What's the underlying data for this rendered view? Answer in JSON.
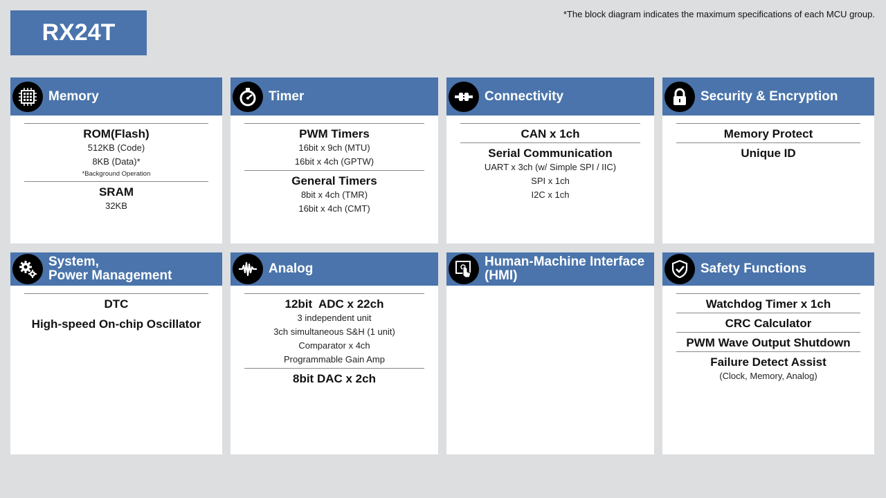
{
  "title": "RX24T",
  "note": "*The block diagram indicates the maximum specifications of each MCU group.",
  "cards": {
    "memory": {
      "title": "Memory",
      "rom_title": "ROM(Flash)",
      "rom_code": "512KB (Code)",
      "rom_data": "8KB (Data)*",
      "rom_note": "*Background Operation",
      "sram_title": "SRAM",
      "sram_size": "32KB"
    },
    "timer": {
      "title": "Timer",
      "pwm_title": "PWM Timers",
      "pwm_1": "16bit x 9ch (MTU)",
      "pwm_2": "16bit x 4ch (GPTW)",
      "gen_title": "General Timers",
      "gen_1": "8bit x 4ch (TMR)",
      "gen_2": "16bit x 4ch (CMT)"
    },
    "connectivity": {
      "title": "Connectivity",
      "can": "CAN x 1ch",
      "serial_title": "Serial Communication",
      "serial_1": "UART x 3ch (w/ Simple SPI / IIC)",
      "serial_2": "SPI x 1ch",
      "serial_3": "I2C x 1ch"
    },
    "security": {
      "title": "Security & Encryption",
      "item_1": "Memory Protect",
      "item_2": "Unique ID"
    },
    "system": {
      "title_line1": "System,",
      "title_line2": "Power Management",
      "item_1": "DTC",
      "item_2": "High-speed On-chip Oscillator"
    },
    "analog": {
      "title": "Analog",
      "adc_title": "12bit  ADC x 22ch",
      "adc_1": "3 independent unit",
      "adc_2": "3ch simultaneous S&H (1 unit)",
      "adc_3": "Comparator x 4ch",
      "adc_4": "Programmable Gain Amp",
      "dac_title": "8bit DAC x 2ch"
    },
    "hmi": {
      "title_line1": "Human-Machine Interface",
      "title_line2": "(HMI)"
    },
    "safety": {
      "title": "Safety Functions",
      "item_1": "Watchdog Timer x 1ch",
      "item_2": "CRC Calculator",
      "item_3": "PWM Wave Output Shutdown",
      "item_4": "Failure Detect Assist",
      "item_4_sub": "(Clock, Memory, Analog)"
    }
  }
}
